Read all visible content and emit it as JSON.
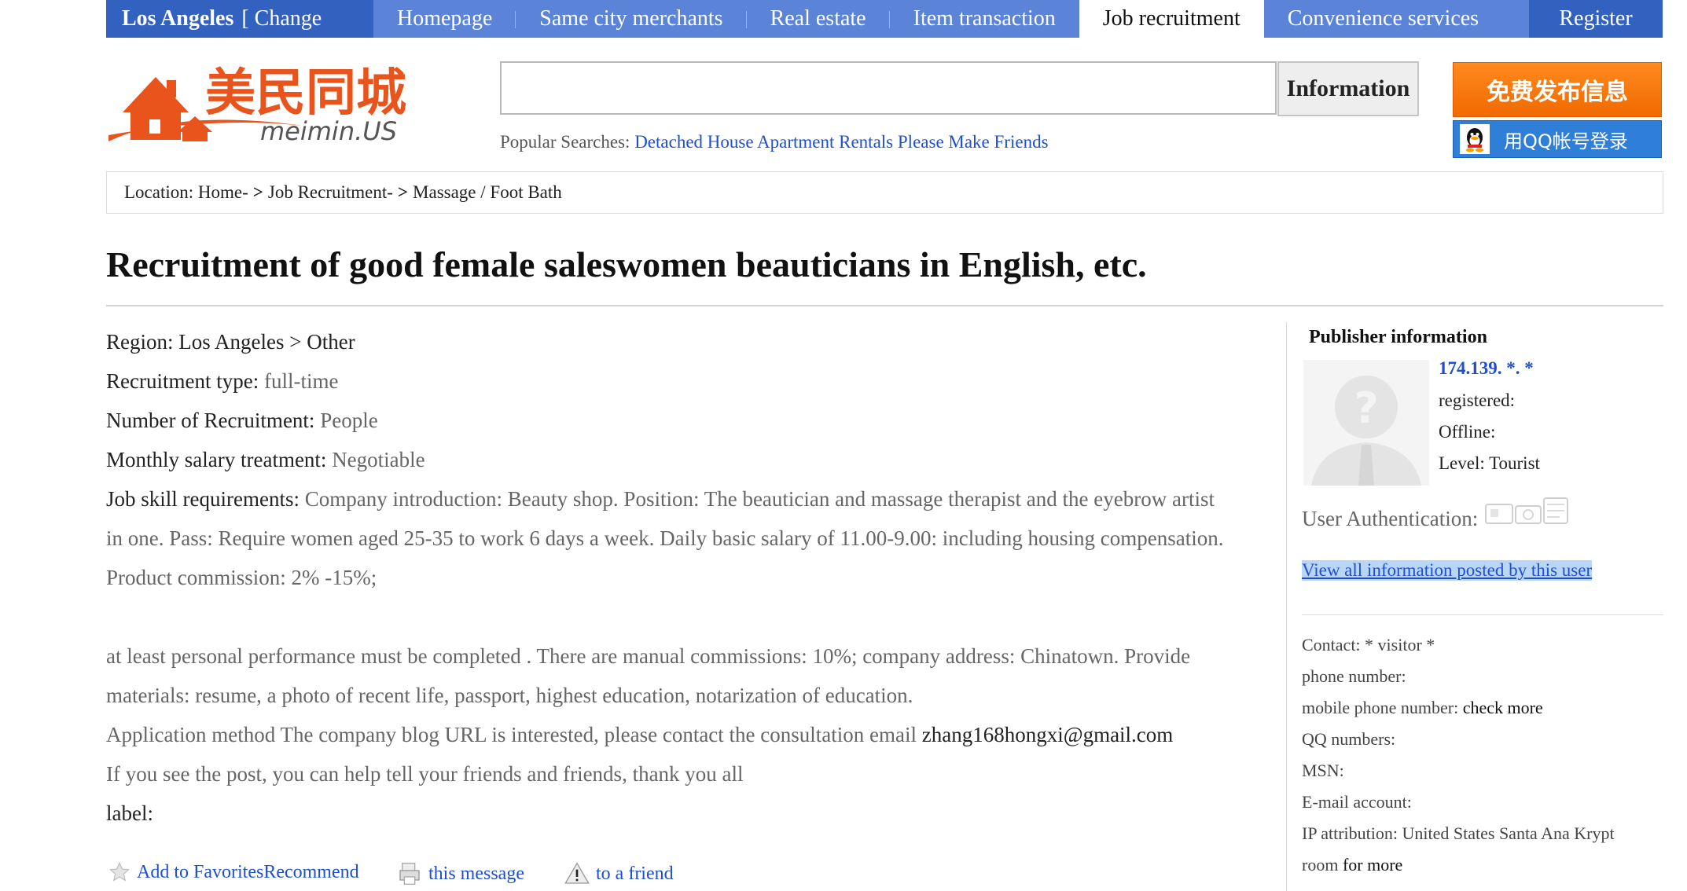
{
  "nav": {
    "city": "Los Angeles",
    "change": "[ Change",
    "items": [
      "Homepage",
      "Same city merchants",
      "Real estate",
      "Item transaction",
      "Job recruitment",
      "Convenience services"
    ],
    "active_index": 4,
    "register": "Register"
  },
  "logo": {
    "chinese": "美民同城",
    "latin": "meimin.US"
  },
  "search": {
    "value": "",
    "button": "Information"
  },
  "popular": {
    "label": "Popular Searches:",
    "links": [
      "Detached House",
      "Apartment Rentals",
      "Please Make Friends"
    ]
  },
  "publish_button": "免费发布信息",
  "qq_button": "用QQ帐号登录",
  "breadcrumb": {
    "label": "Location:",
    "items": [
      "Home-",
      "Job Recruitment-",
      "Massage / Foot Bath"
    ]
  },
  "post": {
    "title": "Recruitment of good female saleswomen beauticians in English, etc.",
    "region_label": "Region:",
    "region_value": "Los Angeles > Other",
    "type_label": "Recruitment type:",
    "type_value": "full-time",
    "number_label": "Number of Recruitment:",
    "number_value": "People",
    "salary_label": "Monthly salary treatment:",
    "salary_value": "Negotiable",
    "skill_label": "Job skill requirements:",
    "skill_line1": "Company introduction: Beauty shop. Position: The beautician and massage therapist and the eyebrow artist",
    "skill_line2": "in one. Pass: Require women aged 25-35 to work 6 days a week. Daily basic salary of 11.00-9.00: including housing compensation.",
    "skill_line3": "Product commission: 2% -15%;",
    "para_line1": "at least personal performance must be completed . There are manual commissions: 10%; company address: Chinatown. Provide",
    "para_line2": "materials: resume, a photo of recent life, passport, highest education, notarization of education.",
    "apply_text": "Application method The company blog URL is interested, please contact the consultation email",
    "email": "zhang168hongxi@gmail.com",
    "share_text": "If you see the post, you can help tell your friends and friends, thank you all",
    "label": "label:"
  },
  "actions": {
    "favorites": "Add to FavoritesRecommend",
    "message": "this message",
    "friend": "to a friend"
  },
  "publisher": {
    "title": "Publisher information",
    "ip": "174.139. *. *",
    "registered": "registered:",
    "status": "Offline:",
    "level": "Level: Tourist",
    "auth_label": "User Authentication:",
    "view_all": "View all information posted by this user",
    "contact": "Contact: * visitor *",
    "phone": "phone number:",
    "mobile_label": "mobile phone number:",
    "mobile_value": "check more",
    "qq": "QQ numbers:",
    "msn": "MSN:",
    "email": "E-mail account:",
    "ip_attr": "IP attribution: United States Santa Ana Krypt",
    "room_label": "room",
    "room_value": "for more"
  }
}
